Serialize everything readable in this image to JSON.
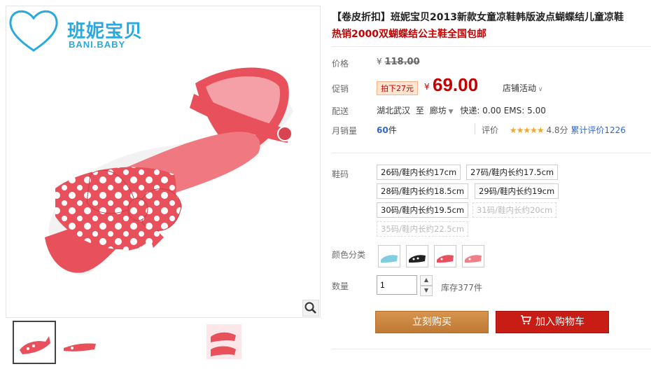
{
  "brand": {
    "logo_script": "Bani Baby",
    "logo_cn": "班妮宝贝",
    "logo_en": "BANI.BABY",
    "color": "#29a9dd"
  },
  "product": {
    "title": "【卷皮折扣】班妮宝贝2013新款女童凉鞋韩版波点蝴蝶结儿童凉鞋",
    "subtitle": "热销2000双蝴蝶结公主鞋全国包邮"
  },
  "price": {
    "label": "价格",
    "yen": "¥",
    "original": "118.00",
    "promo_label": "促销",
    "discount_badge": "拍下27元",
    "current": "69.00",
    "store_activity": "店铺活动"
  },
  "shipping": {
    "label": "配送",
    "from": "湖北武汉",
    "to_word": "至",
    "dest": "廊坊",
    "express": "快递: 0.00 EMS: 5.00"
  },
  "sales": {
    "label": "月销量",
    "count": "60",
    "unit": "件",
    "review_label": "评价",
    "stars": "★★★★★",
    "score": "4.8分",
    "total_reviews": "累计评价1226"
  },
  "sizes": {
    "label": "鞋码",
    "options": [
      {
        "text": "26码/鞋内长约17cm",
        "available": true
      },
      {
        "text": "27码/鞋内长约17.5cm",
        "available": true
      },
      {
        "text": "28码/鞋内长约18.5cm",
        "available": true
      },
      {
        "text": "29码/鞋内长约19cm",
        "available": true
      },
      {
        "text": "30码/鞋内长约19.5cm",
        "available": true
      },
      {
        "text": "31码/鞋内长约20cm",
        "available": false
      },
      {
        "text": "35码/鞋内长约22.5cm",
        "available": false
      }
    ]
  },
  "colors": {
    "label": "颜色分类",
    "swatches": [
      "#7fcde0",
      "#222222",
      "#e8505b",
      "#f08088"
    ]
  },
  "quantity": {
    "label": "数量",
    "value": "1",
    "stock": "库存377件"
  },
  "actions": {
    "buy_now": "立刻购买",
    "add_to_cart": "加入购物车"
  },
  "colors_theme": {
    "price_red": "#c40000",
    "buy_orange": "#c8843c",
    "cart_red": "#c81d14",
    "link_blue": "#3366cc"
  }
}
